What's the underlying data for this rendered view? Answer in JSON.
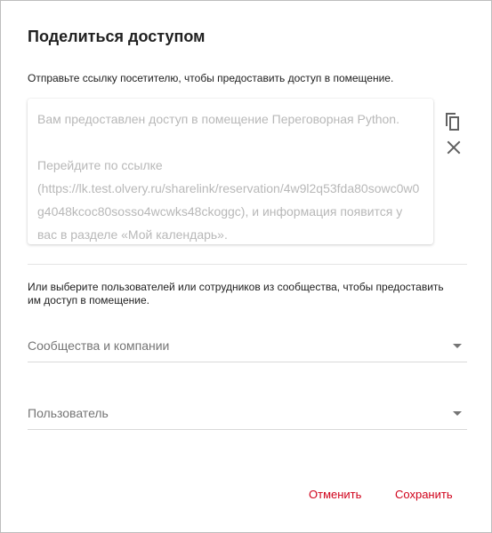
{
  "dialog": {
    "title": "Поделиться доступом",
    "subtitle": "Отправьте ссылку посетителю, чтобы предоставить доступ в помещение.",
    "link_text": {
      "paragraph1": "Вам предоставлен доступ в помещение Переговорная Python.",
      "paragraph2": "Перейдите по ссылке (https://lk.test.olvery.ru/sharelink/reservation/4w9l2q53fda80sowc0w0g4048kcoc80sosso4wcwks48ckoggc), и информация появится у вас в разделе «Мой календарь»."
    },
    "icons": {
      "copy": "copy-icon",
      "close": "close-icon"
    },
    "hint": "Или выберите пользователей или сотрудников из сообщества, чтобы предоставить им доступ в помещение.",
    "communities_select": {
      "label": "Сообщества и компании"
    },
    "user_select": {
      "label": "Пользователь"
    },
    "buttons": {
      "cancel": "Отменить",
      "save": "Сохранить"
    }
  },
  "colors": {
    "accent": "#d0021b",
    "placeholder_text": "#b8b8b8",
    "icon": "#616161"
  }
}
